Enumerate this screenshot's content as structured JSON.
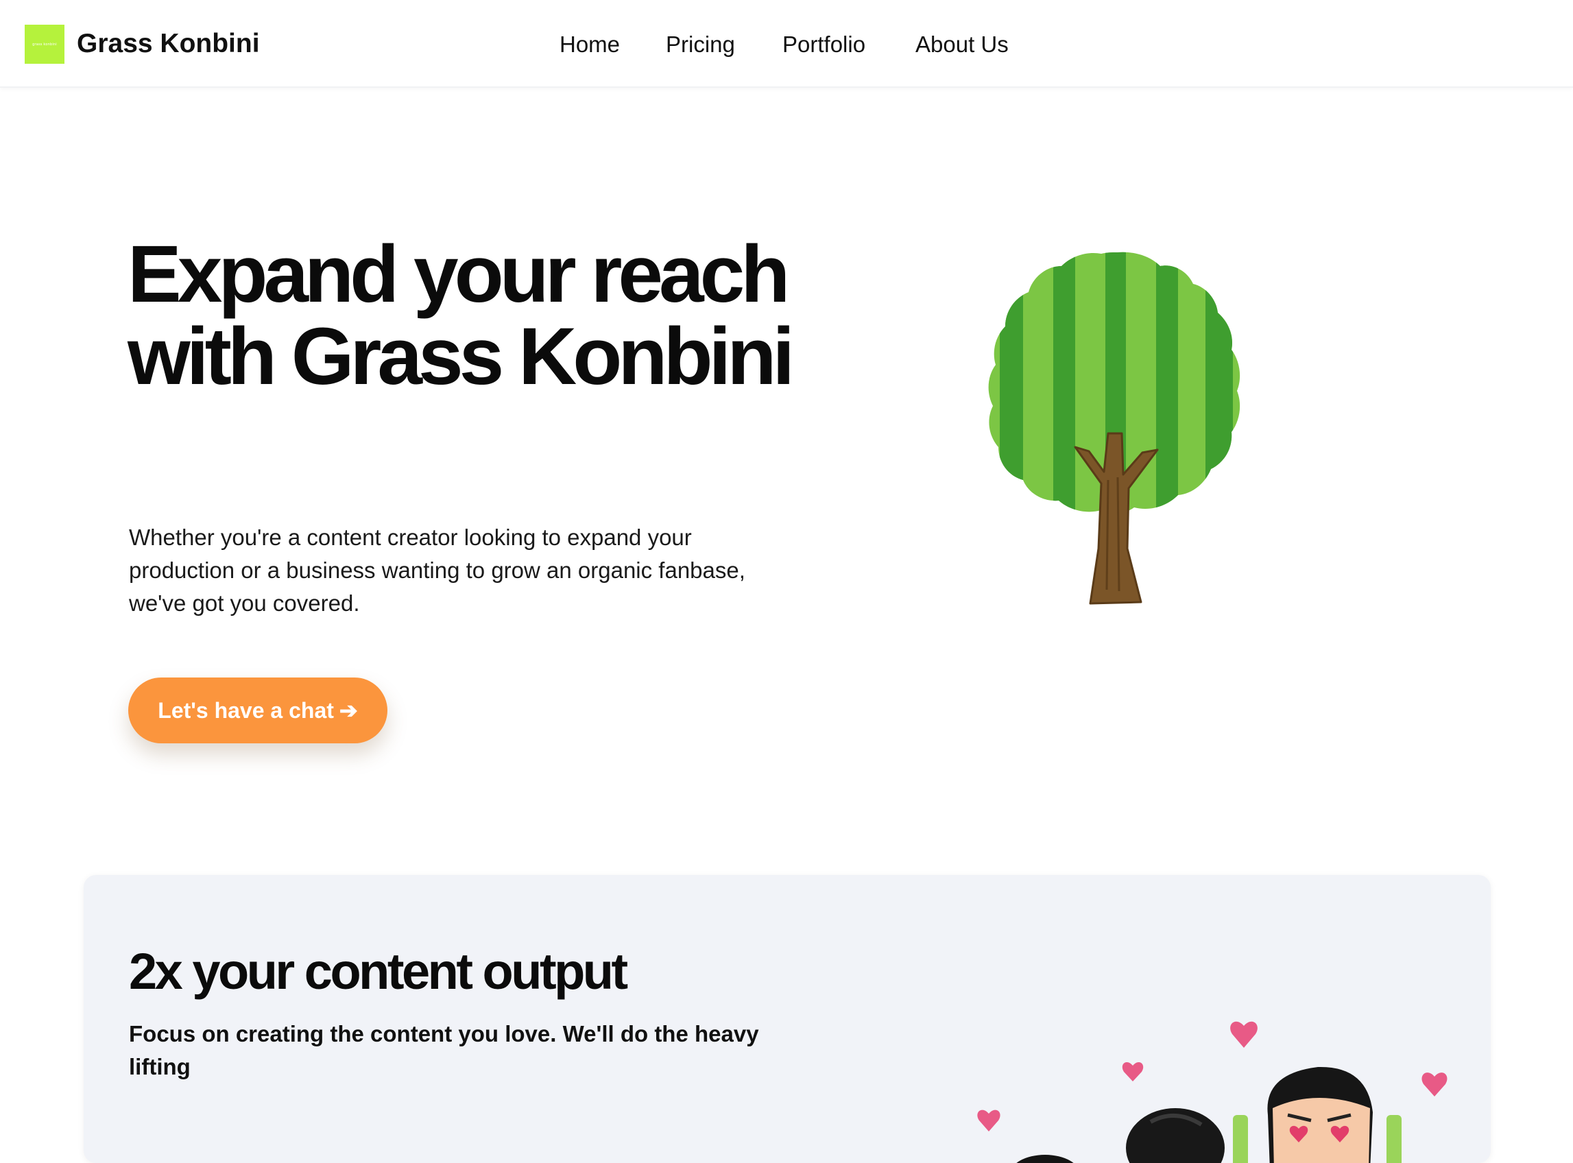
{
  "header": {
    "logo_text": "grass konbini",
    "brand": "Grass Konbini",
    "nav": [
      {
        "label": "Home"
      },
      {
        "label": "Pricing"
      },
      {
        "label": "Portfolio"
      },
      {
        "label": "About Us"
      }
    ]
  },
  "hero": {
    "title": "Expand your reach with Grass Konbini",
    "subtitle": "Whether you're a content creator looking to expand your production or a business wanting to grow an organic fanbase, we've got you covered.",
    "cta_label": "Let's have a chat",
    "cta_icon": "arrow-right-icon",
    "illustration": "tree-illustration"
  },
  "feature": {
    "title": "2x your content output",
    "subtitle": "Focus on creating the content you love. We'll do the heavy lifting",
    "illustration": "excited-people-with-hearts-illustration"
  },
  "colors": {
    "logo_bg": "#b5f23c",
    "cta_bg": "#fb953d",
    "card_bg": "#f1f3f8",
    "tree_leaf_light": "#7cc644",
    "tree_leaf_dark": "#3f9e2f",
    "tree_trunk": "#7b5528",
    "heart": "#e85a86"
  }
}
